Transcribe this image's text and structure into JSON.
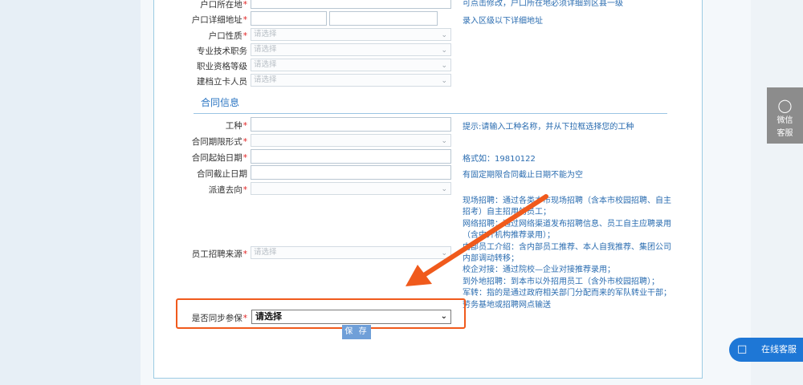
{
  "form": {
    "rows": [
      {
        "label": "户口所在地",
        "required": true,
        "hint": "可点击修改，户口所在地必须详细到区县一级"
      },
      {
        "label": "户口详细地址",
        "required": true,
        "hint": "录入区级以下详细地址"
      },
      {
        "label": "户口性质",
        "required": true,
        "placeholder": "请选择"
      },
      {
        "label": "专业技术职务",
        "required": false,
        "placeholder": "请选择"
      },
      {
        "label": "职业资格等级",
        "required": false,
        "placeholder": "请选择"
      },
      {
        "label": "建档立卡人员",
        "required": false,
        "placeholder": "请选择"
      }
    ],
    "section_title": "合同信息",
    "contract_rows": [
      {
        "label": "工种",
        "required": true,
        "hint": "提示:请输入工种名称，并从下拉框选择您的工种"
      },
      {
        "label": "合同期限形式",
        "required": true
      },
      {
        "label": "合同起始日期",
        "required": true,
        "hint": "格式如：19810122"
      },
      {
        "label": "合同截止日期",
        "required": false,
        "hint": "有固定期限合同截止日期不能为空"
      },
      {
        "label": "派遣去向",
        "required": true
      }
    ],
    "recruit_source": {
      "label": "员工招聘来源",
      "required": true,
      "placeholder": "请选择"
    },
    "recruit_hints": [
      "现场招聘：通过各类本市现场招聘（含本市校园招聘、自主",
      "招考）自主招用的员工；",
      "网络招聘：通过网络渠道发布招聘信息、员工自主应聘录用",
      "（含中介机构推荐录用）；",
      "内部员工介绍：含内部员工推荐、本人自我推荐、集团公司",
      "内部调动转移；",
      "校企对接：通过院校—企业对接推荐录用；",
      "到外地招聘：到本市以外招用员工（含外市校园招聘）；",
      "军转：指的是通过政府相关部门分配而来的军队转业干部；",
      "劳务基地或招聘网点输送"
    ],
    "sync_insurance": {
      "label": "是否同步参保",
      "required": true,
      "value": "请选择"
    },
    "save_label": "保 存"
  },
  "widgets": {
    "wechat_label_line1": "微信",
    "wechat_label_line2": "客服",
    "online_service_label": "在线客服"
  },
  "colors": {
    "accent_blue": "#2a74c2",
    "hint_blue": "#2a6cb0",
    "required_red": "#e02020",
    "highlight_orange": "#f05a1c",
    "online_button": "#1e77d6"
  }
}
